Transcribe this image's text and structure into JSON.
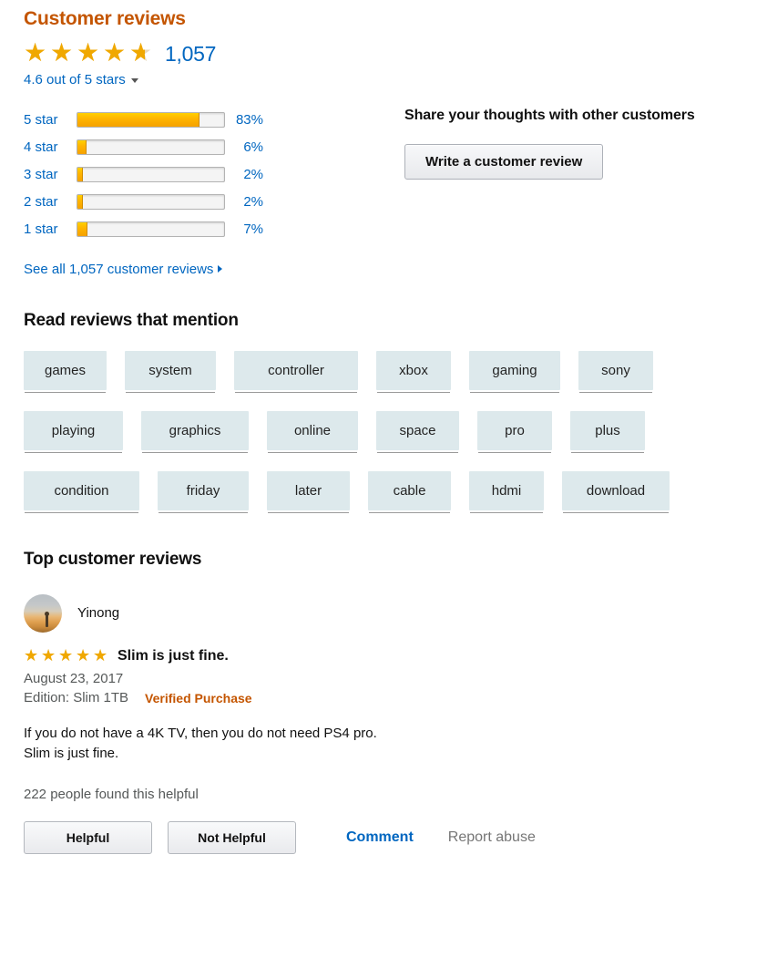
{
  "reviews_summary": {
    "heading": "Customer reviews",
    "rating_value": 4.6,
    "total_reviews_display": "1,057",
    "out_of_text": "4.6 out of 5 stars",
    "caret_icon": "chevron-down-icon",
    "see_all_link": "See all 1,057 customer reviews",
    "see_all_arrow_icon": "arrow-right-icon",
    "histogram": [
      {
        "label": "5 star",
        "percent": 83,
        "percent_label": "83%"
      },
      {
        "label": "4 star",
        "percent": 6,
        "percent_label": "6%"
      },
      {
        "label": "3 star",
        "percent": 2,
        "percent_label": "2%"
      },
      {
        "label": "2 star",
        "percent": 2,
        "percent_label": "2%"
      },
      {
        "label": "1 star",
        "percent": 7,
        "percent_label": "7%"
      }
    ]
  },
  "share_panel": {
    "title": "Share your thoughts with other customers",
    "write_review_button": "Write a customer review"
  },
  "mentions": {
    "heading": "Read reviews that mention",
    "rows": [
      [
        "games",
        "system",
        "controller",
        "xbox",
        "gaming",
        "sony"
      ],
      [
        "playing",
        "graphics",
        "online",
        "space",
        "pro",
        "plus"
      ],
      [
        "condition",
        "friday",
        "later",
        "cable",
        "hdmi",
        "download"
      ]
    ]
  },
  "top_reviews": {
    "heading": "Top customer reviews",
    "items": [
      {
        "avatar_icon": "avatar-landscape-photo",
        "author": "Yinong",
        "stars": 5,
        "title": "Slim is just fine.",
        "date": "August 23, 2017",
        "edition": "Edition: Slim 1TB",
        "verified_badge": "Verified Purchase",
        "body_lines": [
          "If you do not have a 4K TV, then you do not need PS4 pro.",
          "Slim is just fine."
        ],
        "helpful_count_text": "222 people found this helpful",
        "helpful_button": "Helpful",
        "not_helpful_button": "Not Helpful",
        "comment_link": "Comment",
        "report_link": "Report abuse"
      }
    ]
  },
  "colors": {
    "brand_orange": "#c45500",
    "star_gold": "#f0a800",
    "link_blue": "#0066c0",
    "tag_bg": "#dde9ec",
    "muted_gray": "#565959"
  }
}
